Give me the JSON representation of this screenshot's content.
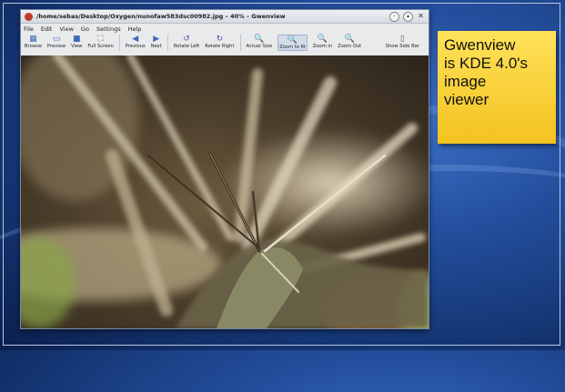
{
  "window": {
    "title": "/home/sebas/Desktop/Oxygen/nunofaw583dsc00982.jpg – 40% – Gwenview"
  },
  "menu": [
    "File",
    "Edit",
    "View",
    "Go",
    "Settings",
    "Help"
  ],
  "toolbar": {
    "browse": "Browse",
    "preview": "Preview",
    "view": "View",
    "fullscreen": "Full Screen",
    "previous": "Previous",
    "next": "Next",
    "rotate_left": "Rotate Left",
    "rotate_right": "Rotate Right",
    "actual_size": "Actual Size",
    "zoom_to_fit": "Zoom to fit",
    "zoom_in": "Zoom in",
    "zoom_out": "Zoom Out",
    "show_sidebar": "Show Side Bar"
  },
  "note": {
    "lines": [
      "Gwenview",
      "is KDE 4.0's",
      "image",
      "viewer"
    ]
  },
  "colors": {
    "note_bg": "#f7cf2e",
    "desktop_bg": "#244f9e",
    "toolbar_icon": "#3b6ab8"
  }
}
